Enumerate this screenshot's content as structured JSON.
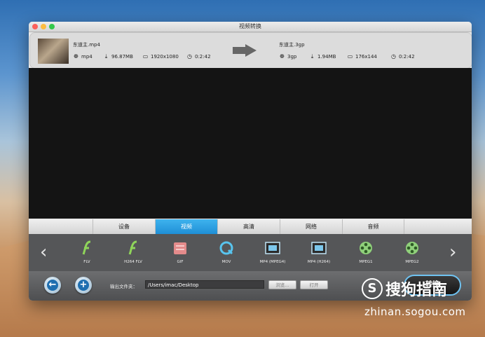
{
  "window": {
    "title": "视频转换"
  },
  "source": {
    "filename": "东道主.mp4",
    "format": "mp4",
    "size": "96.87MB",
    "resolution": "1920x1080",
    "duration": "0:2:42"
  },
  "target": {
    "filename": "东道主.3gp",
    "format": "3gp",
    "size": "1.94MB",
    "resolution": "176x144",
    "duration": "0:2:42"
  },
  "tabs": [
    {
      "label": "设备",
      "active": false
    },
    {
      "label": "视频",
      "active": true
    },
    {
      "label": "高清",
      "active": false
    },
    {
      "label": "网络",
      "active": false
    },
    {
      "label": "音频",
      "active": false
    }
  ],
  "formats": [
    {
      "label": "FLV",
      "icon": "flash-icon"
    },
    {
      "label": "H264 FLV",
      "icon": "flash-icon"
    },
    {
      "label": "GIF",
      "icon": "gif-icon"
    },
    {
      "label": "MOV",
      "icon": "quicktime-icon"
    },
    {
      "label": "MP4 (MPEG4)",
      "icon": "film-icon"
    },
    {
      "label": "MP4 (H264)",
      "icon": "film-icon"
    },
    {
      "label": "MPEG1",
      "icon": "reel-icon"
    },
    {
      "label": "MPEG2",
      "icon": "reel-icon"
    }
  ],
  "output": {
    "label": "输出文件夹：",
    "path": "/Users/imac/Desktop",
    "browse_label": "浏览...",
    "open_label": "打开"
  },
  "convert_label": "转换",
  "watermark": {
    "brand": "搜狗指南",
    "url": "zhinan.sogou.com"
  },
  "colors": {
    "active_tab": "#1f8fd6",
    "convert_border": "#6fc3f2"
  }
}
